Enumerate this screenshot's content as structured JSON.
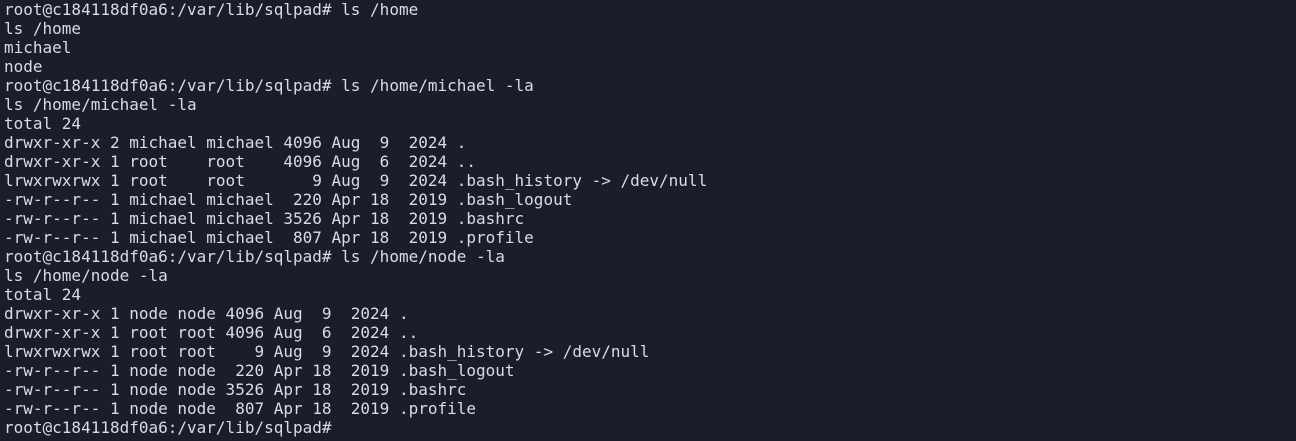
{
  "terminal": {
    "lines": [
      "root@c184118df0a6:/var/lib/sqlpad# ls /home",
      "ls /home",
      "michael",
      "node",
      "root@c184118df0a6:/var/lib/sqlpad# ls /home/michael -la",
      "ls /home/michael -la",
      "total 24",
      "drwxr-xr-x 2 michael michael 4096 Aug  9  2024 .",
      "drwxr-xr-x 1 root    root    4096 Aug  6  2024 ..",
      "lrwxrwxrwx 1 root    root       9 Aug  9  2024 .bash_history -> /dev/null",
      "-rw-r--r-- 1 michael michael  220 Apr 18  2019 .bash_logout",
      "-rw-r--r-- 1 michael michael 3526 Apr 18  2019 .bashrc",
      "-rw-r--r-- 1 michael michael  807 Apr 18  2019 .profile",
      "root@c184118df0a6:/var/lib/sqlpad# ls /home/node -la",
      "ls /home/node -la",
      "total 24",
      "drwxr-xr-x 1 node node 4096 Aug  9  2024 .",
      "drwxr-xr-x 1 root root 4096 Aug  6  2024 ..",
      "lrwxrwxrwx 1 root root    9 Aug  9  2024 .bash_history -> /dev/null",
      "-rw-r--r-- 1 node node  220 Apr 18  2019 .bash_logout",
      "-rw-r--r-- 1 node node 3526 Apr 18  2019 .bashrc",
      "-rw-r--r-- 1 node node  807 Apr 18  2019 .profile",
      "root@c184118df0a6:/var/lib/sqlpad# "
    ],
    "colors": {
      "background": "#1b1d2b",
      "foreground": "#d9dce4"
    }
  }
}
